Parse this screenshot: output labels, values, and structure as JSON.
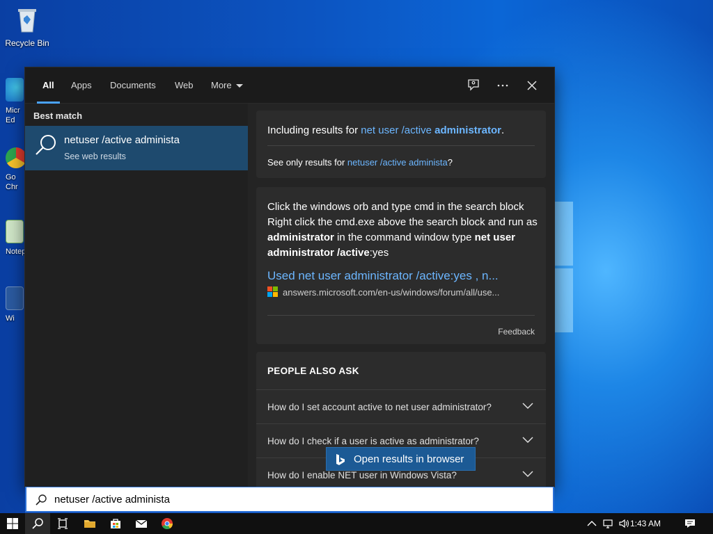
{
  "desktop": {
    "icons": [
      {
        "label": "Recycle Bin"
      },
      {
        "label": "Micr\nEd"
      },
      {
        "label": "Go\nChr"
      },
      {
        "label": "Notep"
      },
      {
        "label": "Wi"
      }
    ]
  },
  "search": {
    "tabs": [
      {
        "label": "All",
        "active": true
      },
      {
        "label": "Apps"
      },
      {
        "label": "Documents"
      },
      {
        "label": "Web"
      },
      {
        "label": "More"
      }
    ],
    "best_match_label": "Best match",
    "best_match": {
      "title": "netuser /active administa",
      "subtitle": "See web results"
    },
    "including": {
      "prefix": "Including results for ",
      "query_normal": "net user /active ",
      "query_bold": "administrator",
      "suffix": "."
    },
    "see_only": {
      "prefix": "See only results for ",
      "query": "netuser /active administa",
      "suffix": "?"
    },
    "answer": {
      "text_1": "Click the windows orb and type cmd in the search block Right click the cmd.exe above the search block and run as ",
      "bold_1": "administrator",
      "text_2": " in the command window type ",
      "bold_2": "net user administrator /active",
      "text_3": ":yes",
      "link_title": "Used net user administrator /active:yes , n...",
      "source": "answers.microsoft.com/en-us/windows/forum/all/use...",
      "feedback": "Feedback"
    },
    "people_also_ask": {
      "heading": "PEOPLE ALSO ASK",
      "questions": [
        "How do I set account active to net user administrator?",
        "How do I check if a user is active as administrator?",
        "How do I enable NET user in Windows Vista?"
      ]
    },
    "open_browser": "Open results in browser",
    "query": "netuser /active administa"
  },
  "taskbar": {
    "time": "1:43 AM"
  },
  "colors": {
    "accent": "#4aa3ff",
    "link": "#6cb6ff",
    "selected": "#1e4a6e"
  }
}
